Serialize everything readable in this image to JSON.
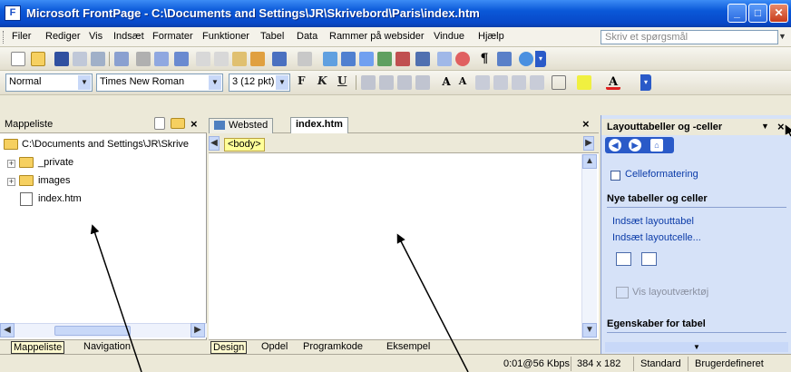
{
  "titlebar": {
    "app_icon": "frontpage-icon",
    "title": "Microsoft FrontPage - C:\\Documents and Settings\\JR\\Skrivebord\\Paris\\index.htm",
    "min": "minimize-icon",
    "max": "maximize-icon",
    "close": "close-icon"
  },
  "menu": {
    "items": [
      "Filer",
      "Rediger",
      "Vis",
      "Indsæt",
      "Formater",
      "Funktioner",
      "Tabel",
      "Data",
      "Rammer på websider",
      "Vindue",
      "Hjælp"
    ],
    "ask_placeholder": "Skriv et spørgsmål"
  },
  "format_toolbar": {
    "style": "Normal",
    "font": "Times New Roman",
    "size": "3 (12 pkt)",
    "bold": "F",
    "italic": "K",
    "underline": "U"
  },
  "folder_list": {
    "title": "Mappeliste",
    "root": "C:\\Documents and Settings\\JR\\Skrive",
    "items": [
      {
        "label": "_private",
        "type": "folder"
      },
      {
        "label": "images",
        "type": "folder"
      },
      {
        "label": "index.htm",
        "type": "file"
      }
    ],
    "tabs": [
      "Mappeliste",
      "Navigation"
    ]
  },
  "editor": {
    "tabs": [
      "Websted",
      "index.htm"
    ],
    "tag": "<body>",
    "views": [
      "Design",
      "Opdel",
      "Programkode",
      "Eksempel"
    ]
  },
  "task_pane": {
    "title": "Layouttabeller og -celler",
    "cell_format_link": "Celleformatering",
    "section1": "Nye tabeller og celler",
    "insert_table_link": "Indsæt layouttabel",
    "insert_cell_link": "Indsæt layoutcelle...",
    "show_tool": "Vis layoutværktøj",
    "section2": "Egenskaber for tabel"
  },
  "status": {
    "speed": "0:01@56 Kbps",
    "size": "384 x 182",
    "mode": "Standard",
    "custom": "Brugerdefineret"
  }
}
